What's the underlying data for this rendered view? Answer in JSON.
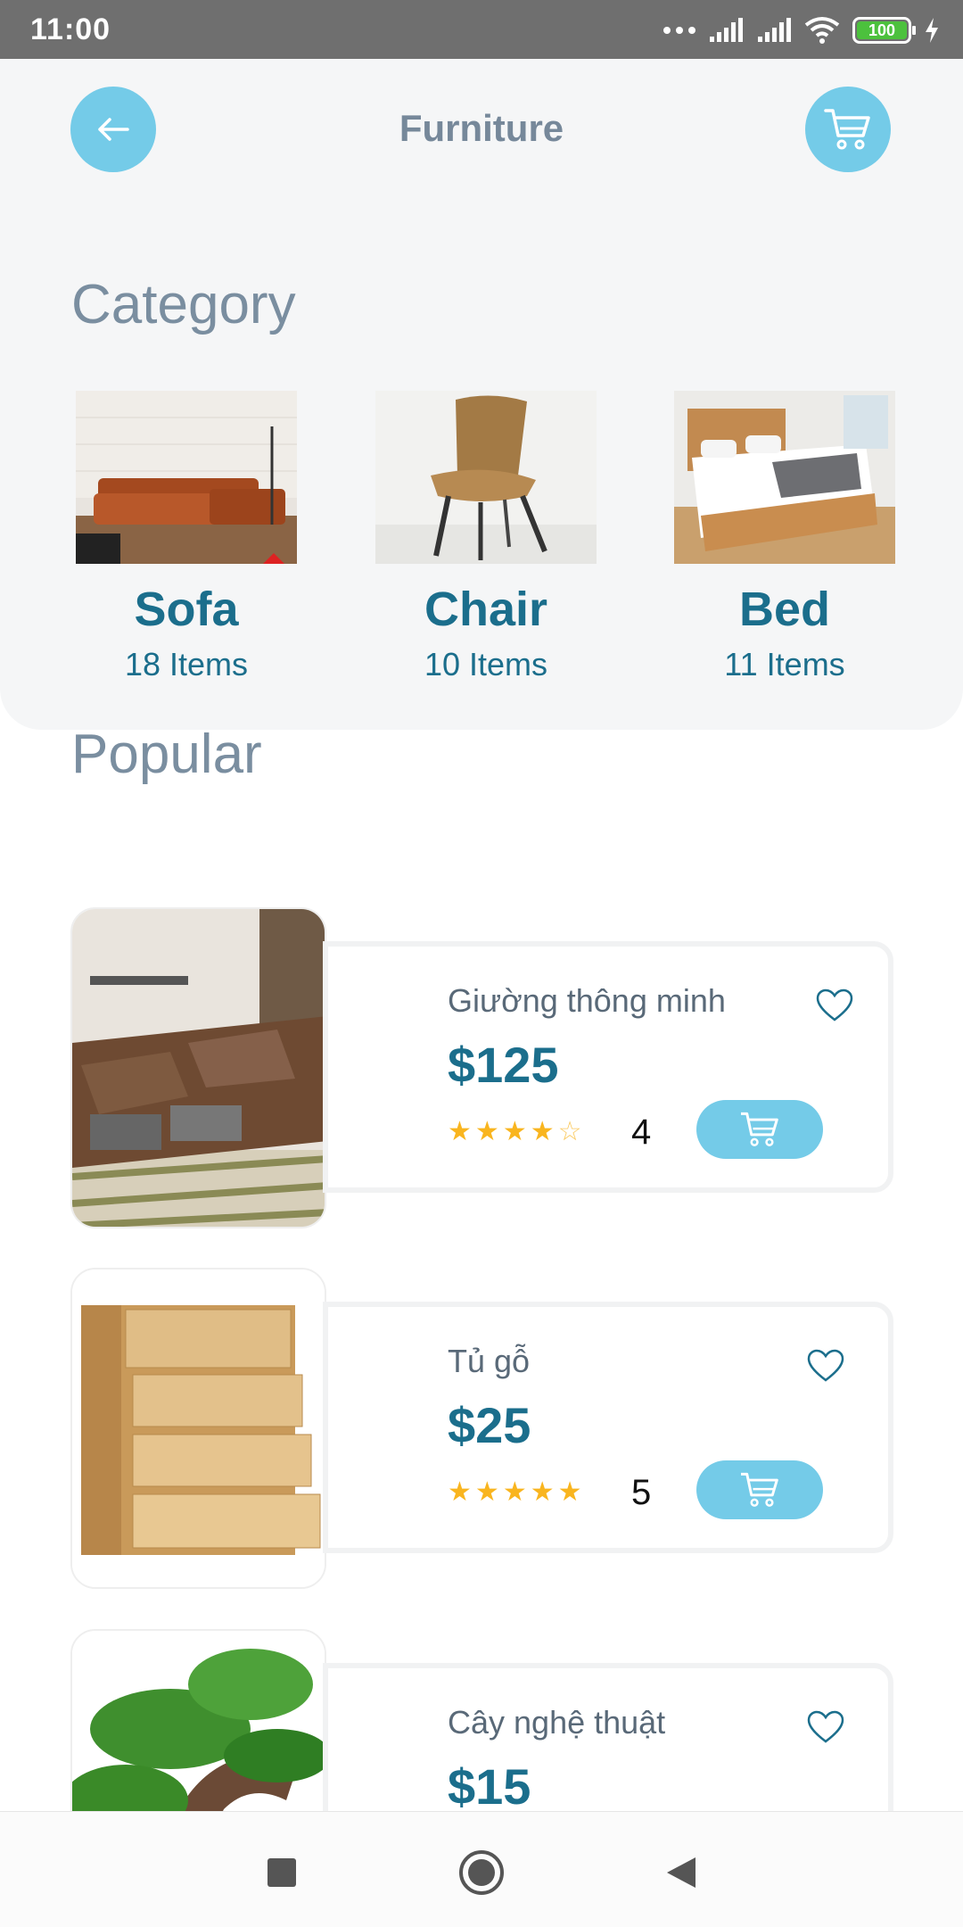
{
  "status": {
    "time": "11:00",
    "battery": "100"
  },
  "header": {
    "title": "Furniture"
  },
  "category": {
    "title": "Category",
    "items": [
      {
        "name": "Sofa",
        "count": "18 Items",
        "icon": "sofa-image"
      },
      {
        "name": "Chair",
        "count": "10 Items",
        "icon": "chair-image"
      },
      {
        "name": "Bed",
        "count": "11 Items",
        "icon": "bed-image"
      }
    ]
  },
  "popular": {
    "title": "Popular",
    "products": [
      {
        "name": "Giường thông minh",
        "price": "$125",
        "rating": "4",
        "stars": "★★★★☆"
      },
      {
        "name": "Tủ gỗ",
        "price": "$25",
        "rating": "5",
        "stars": "★★★★★"
      },
      {
        "name": "Cây nghệ thuật",
        "price": "$15"
      }
    ]
  },
  "colors": {
    "accent": "#74cbe8",
    "primary_text": "#1b6e8c",
    "star": "#f9b51f",
    "muted_title": "#7a8ea0"
  }
}
